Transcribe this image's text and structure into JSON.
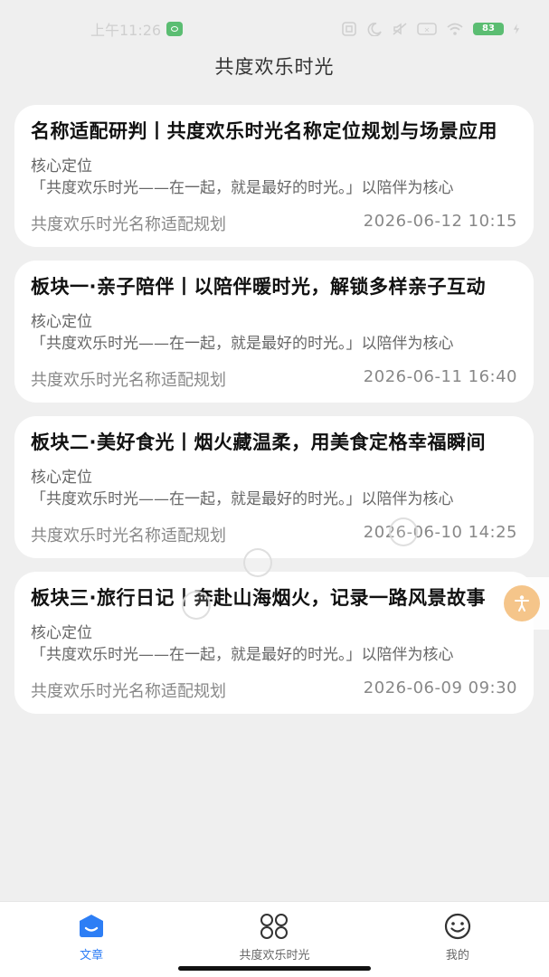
{
  "status_bar": {
    "time": "上午11:26",
    "battery": "83"
  },
  "header": {
    "title": "共度欢乐时光"
  },
  "articles": [
    {
      "title": "名称适配研判丨共度欢乐时光名称定位规划与场景应用",
      "label": "核心定位",
      "excerpt": "「共度欢乐时光——在一起，就是最好的时光。」以陪伴为核心",
      "category": "共度欢乐时光名称适配规划",
      "date": "2026-06-12 10:15"
    },
    {
      "title": "板块一·亲子陪伴丨以陪伴暖时光，解锁多样亲子互动",
      "label": "核心定位",
      "excerpt": "「共度欢乐时光——在一起，就是最好的时光。」以陪伴为核心",
      "category": "共度欢乐时光名称适配规划",
      "date": "2026-06-11 16:40"
    },
    {
      "title": "板块二·美好食光丨烟火藏温柔，用美食定格幸福瞬间",
      "label": "核心定位",
      "excerpt": "「共度欢乐时光——在一起，就是最好的时光。」以陪伴为核心",
      "category": "共度欢乐时光名称适配规划",
      "date": "2026-06-10 14:25"
    },
    {
      "title": "板块三·旅行日记丨奔赴山海烟火，记录一路风景故事",
      "label": "核心定位",
      "excerpt": "「共度欢乐时光——在一起，就是最好的时光。」以陪伴为核心",
      "category": "共度欢乐时光名称适配规划",
      "date": "2026-06-09 09:30"
    }
  ],
  "tabs": [
    {
      "label": "文章",
      "icon": "article-icon",
      "active": true
    },
    {
      "label": "共度欢乐时光",
      "icon": "grid-icon",
      "active": false
    },
    {
      "label": "我的",
      "icon": "smiley-icon",
      "active": false
    }
  ],
  "colors": {
    "accent": "#2d7ef5",
    "background": "#efefef",
    "card": "#ffffff",
    "fab": "#f5c58a"
  }
}
